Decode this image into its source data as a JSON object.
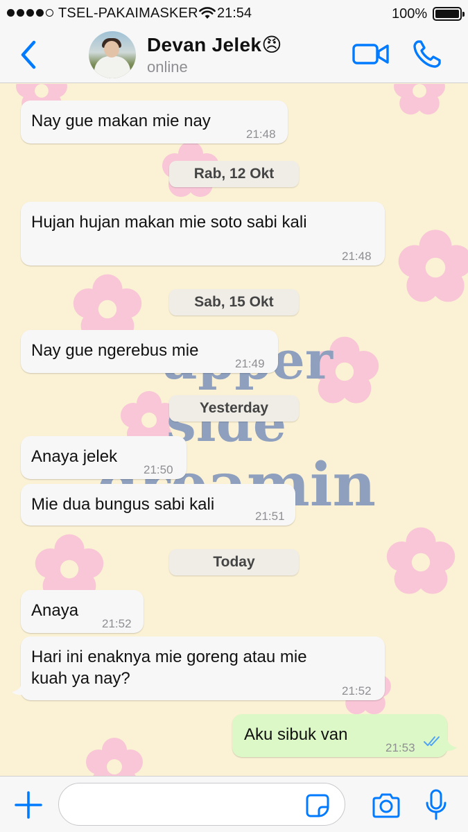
{
  "status_bar": {
    "carrier": "TSEL-PAKAIMASKER",
    "time": "21:54",
    "battery": "100%"
  },
  "header": {
    "contact_name": "Devan Jelek😠",
    "contact_status": "online"
  },
  "wallpaper": {
    "text_line1": "upper",
    "text_line2": "side",
    "text_line3": "dreamin"
  },
  "messages": [
    {
      "text": "Nay gue makan mie nay",
      "time": "21:48"
    },
    {
      "text": "Hujan hujan makan mie soto sabi kali",
      "time": "21:48"
    },
    {
      "text": "Nay gue ngerebus mie",
      "time": "21:49"
    },
    {
      "text": "Anaya jelek",
      "time": "21:50"
    },
    {
      "text": "Mie dua bungus sabi kali",
      "time": "21:51"
    },
    {
      "text": "Anaya",
      "time": "21:52"
    },
    {
      "text": "Hari ini enaknya mie goreng atau mie\nkuah ya nay?",
      "time": "21:52"
    },
    {
      "text": "Aku sibuk van",
      "time": "21:53",
      "read": true
    }
  ],
  "date_separators": [
    "Rab, 12 Okt",
    "Sab, 15 Okt",
    "Yesterday",
    "Today"
  ],
  "input": {
    "placeholder": ""
  },
  "colors": {
    "accent": "#007aff",
    "incoming_bubble": "#f7f7f7",
    "outgoing_bubble": "#dcf8c6",
    "wallpaper": "#fbf1d4",
    "flower": "#f8c6d6"
  },
  "icons": [
    "back-chevron-icon",
    "video-call-icon",
    "phone-icon",
    "plus-icon",
    "sticker-icon",
    "camera-icon",
    "microphone-icon",
    "double-check-icon"
  ]
}
